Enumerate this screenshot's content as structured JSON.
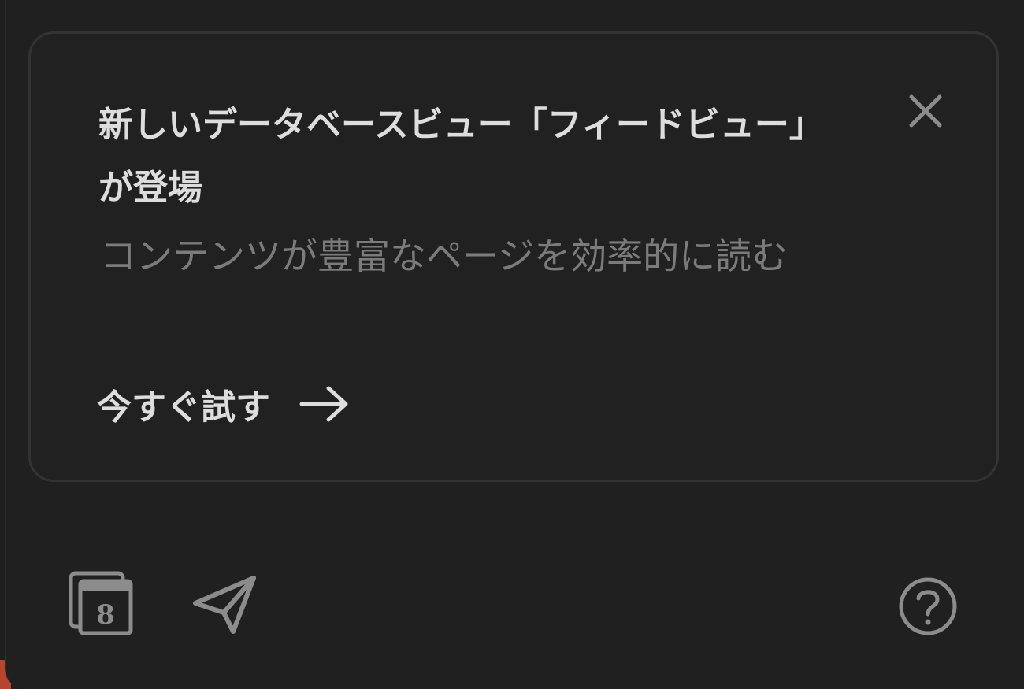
{
  "promo_card": {
    "title": "新しいデータベースビュー「フィードビュー」が登場",
    "subtitle": "コンテンツが豊富なページを効率的に読む",
    "cta_label": "今すぐ試す",
    "cta_icon": "arrow-right-icon",
    "close_icon": "close-icon"
  },
  "footer": {
    "calendar": {
      "icon": "calendar-icon",
      "day": "8"
    },
    "send_icon": "send-icon",
    "help_icon": "help-icon"
  },
  "colors": {
    "background": "#202020",
    "card_border": "#333333",
    "title_text": "#dddddd",
    "subtitle_text": "#7b7b7b",
    "icon_color": "#8c8c8c",
    "accent": "#b7452e"
  }
}
